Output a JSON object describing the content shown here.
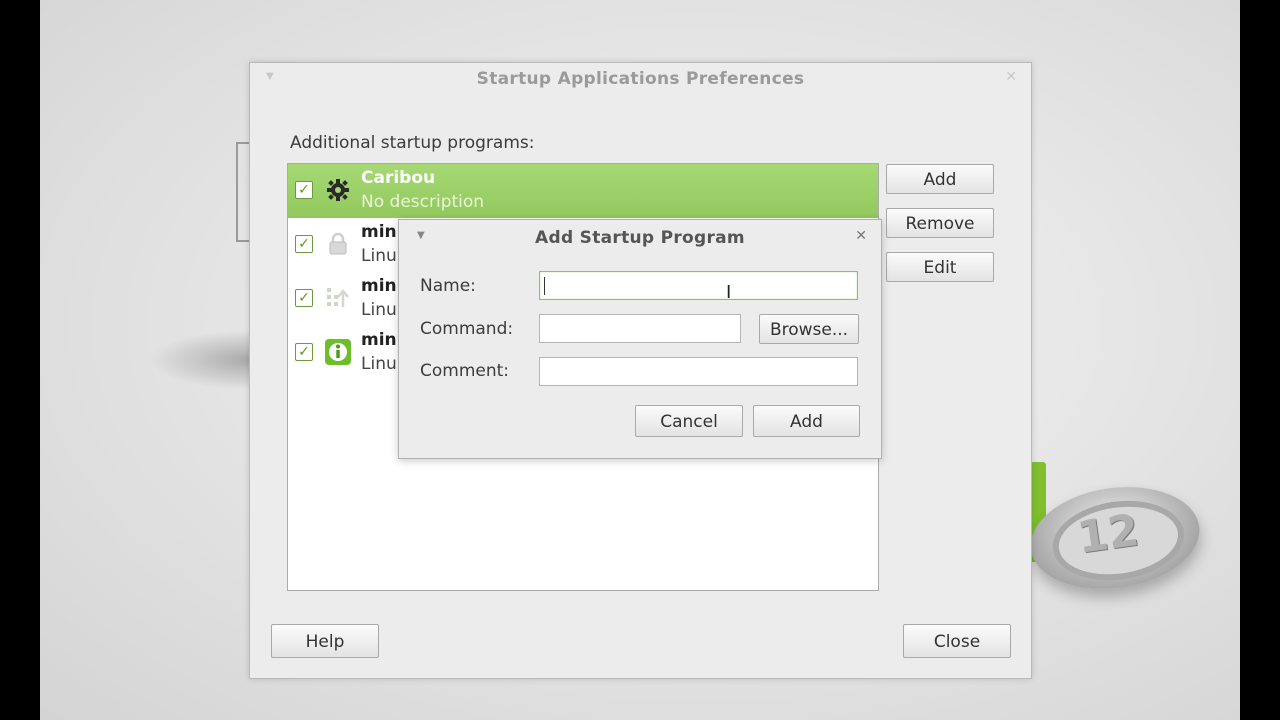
{
  "main_window": {
    "title": "Startup Applications Preferences",
    "section_label": "Additional startup programs:",
    "programs": [
      {
        "name": "Caribou",
        "description": "No description",
        "enabled": true,
        "selected": true,
        "icon": "gear-icon"
      },
      {
        "name": "min",
        "description": "Linu",
        "enabled": true,
        "selected": false,
        "icon": "lock-icon"
      },
      {
        "name": "min",
        "description": "Linu",
        "enabled": true,
        "selected": false,
        "icon": "update-icon"
      },
      {
        "name": "min",
        "description": "Linu",
        "enabled": true,
        "selected": false,
        "icon": "info-icon"
      }
    ],
    "buttons": {
      "add": "Add",
      "remove": "Remove",
      "edit": "Edit",
      "help": "Help",
      "close": "Close"
    }
  },
  "dialog": {
    "title": "Add Startup Program",
    "name_label": "Name:",
    "name_value": "",
    "command_label": "Command:",
    "command_value": "",
    "browse": "Browse...",
    "comment_label": "Comment:",
    "comment_value": "",
    "cancel": "Cancel",
    "add": "Add"
  },
  "colors": {
    "selection": "#9fd46c",
    "accent_green": "#7fbf30"
  },
  "background_logo_text": "12"
}
